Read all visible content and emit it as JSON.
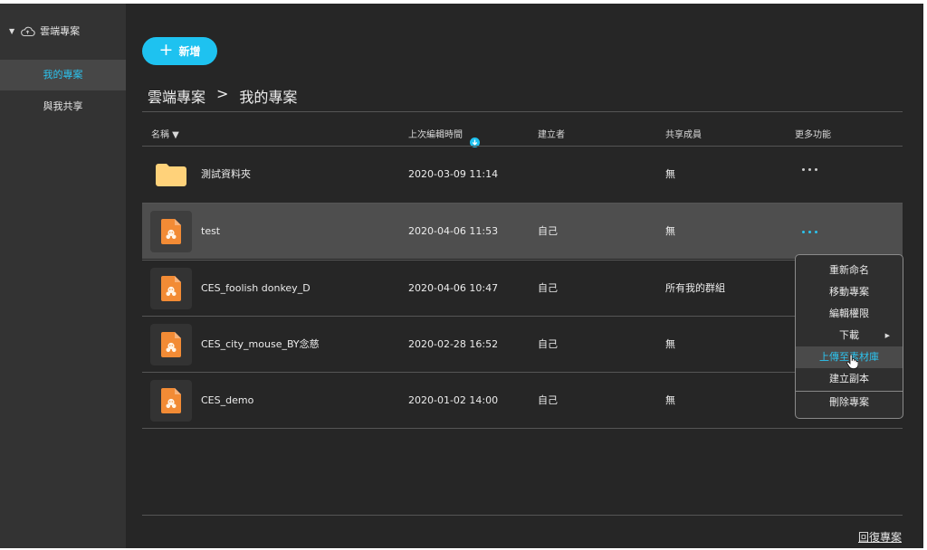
{
  "sidebar": {
    "root_label": "雲端專案",
    "items": [
      {
        "label": "我的專案",
        "active": true
      },
      {
        "label": "與我共享",
        "active": false
      }
    ]
  },
  "toolbar": {
    "new_label": "新增"
  },
  "breadcrumb": {
    "root": "雲端專案",
    "separator": ">",
    "current": "我的專案"
  },
  "table": {
    "headers": {
      "name": "名稱 ▼",
      "modified": "上次編輯時間",
      "creator": "建立者",
      "members": "共享成員",
      "more": "更多功能"
    },
    "rows": [
      {
        "name": "測試資料夾",
        "type": "folder",
        "modified": "2020-03-09 11:14",
        "creator": "",
        "members": "無"
      },
      {
        "name": "test",
        "type": "project",
        "modified": "2020-04-06 11:53",
        "creator": "自己",
        "members": "無"
      },
      {
        "name": "CES_foolish donkey_D",
        "type": "project",
        "modified": "2020-04-06 10:47",
        "creator": "自己",
        "members": "所有我的群組"
      },
      {
        "name": "CES_city_mouse_BY念慈",
        "type": "project",
        "modified": "2020-02-28 16:52",
        "creator": "自己",
        "members": "無"
      },
      {
        "name": "CES_demo",
        "type": "project",
        "modified": "2020-01-02 14:00",
        "creator": "自己",
        "members": "無"
      }
    ]
  },
  "context_menu": {
    "items": [
      "重新命名",
      "移動專案",
      "編輯權限",
      "下載",
      "上傳至素材庫",
      "建立副本",
      "刪除專案"
    ]
  },
  "footer": {
    "restore_label": "回復專案"
  },
  "colors": {
    "accent": "#1ec2f0",
    "background": "#262626",
    "sidebar": "#333333",
    "folder": "#ffd27a",
    "project_icon": "#f28b35"
  }
}
